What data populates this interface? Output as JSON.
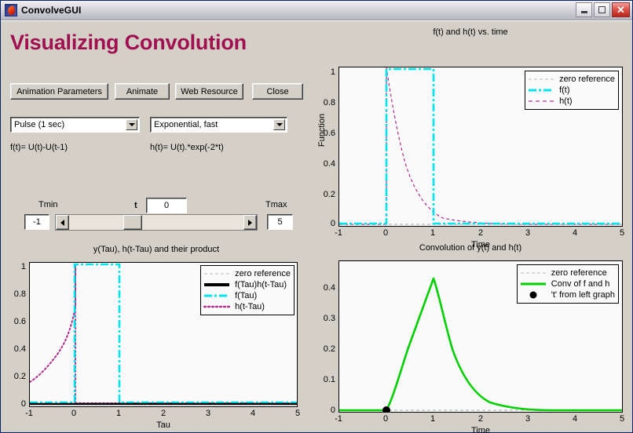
{
  "window": {
    "title": "ConvolveGUI",
    "icon": "matlab-icon",
    "minimize_label": "Minimize",
    "maximize_label": "Maximize",
    "close_label": "Close"
  },
  "header": {
    "heading": "Visualizing Convolution",
    "heading_color": "#a01050"
  },
  "toolbar": {
    "buttons": [
      {
        "label": "Animation Parameters",
        "name": "animation-parameters-button"
      },
      {
        "label": "Animate",
        "name": "animate-button"
      },
      {
        "label": "Web Resource",
        "name": "web-resource-button"
      },
      {
        "label": "Close",
        "name": "close-button"
      }
    ]
  },
  "selectors": {
    "f_select": {
      "value": "Pulse (1 sec)",
      "options": [
        "Pulse (1 sec)"
      ]
    },
    "h_select": {
      "value": "Exponential, fast",
      "options": [
        "Exponential, fast"
      ]
    },
    "f_formula": "f(t)= U(t)-U(t-1)",
    "h_formula": "h(t)= U(t).*exp(-2*t)"
  },
  "slider_panel": {
    "tmin_label": "Tmin",
    "tmin_value": "-1",
    "t_label": "t",
    "t_value": "0",
    "tmax_label": "Tmax",
    "tmax_value": "5",
    "left_arrow": "left-arrow",
    "right_arrow": "right-arrow"
  },
  "chart_data": [
    {
      "id": "top-right",
      "type": "line",
      "title": "f(t) and h(t) vs. time",
      "xlabel": "Time",
      "ylabel": "Function",
      "xlim": [
        -1,
        5
      ],
      "ylim": [
        0,
        1.05
      ],
      "xticks": [
        "-1",
        "0",
        "1",
        "2",
        "3",
        "4",
        "5"
      ],
      "yticks": [
        "0",
        "0.2",
        "0.4",
        "0.6",
        "0.8",
        "1"
      ],
      "grid": false,
      "legend_position": "top-right",
      "series": [
        {
          "name": "zero reference",
          "color": "#aaaaaa",
          "style": "dashed",
          "width": 1
        },
        {
          "name": "f(t)",
          "color": "#00e5ee",
          "style": "dash-dot",
          "width": 2.5,
          "points": [
            [
              -1,
              0
            ],
            [
              0,
              0
            ],
            [
              0,
              1
            ],
            [
              1,
              1
            ],
            [
              1,
              0
            ],
            [
              5,
              0
            ]
          ]
        },
        {
          "name": "h(t)",
          "color": "#b03090",
          "style": "dashed",
          "width": 1,
          "description": "U(t).*exp(-2*t)"
        }
      ]
    },
    {
      "id": "bottom-left",
      "type": "line",
      "title": "y(Tau), h(t-Tau) and their product",
      "xlabel": "Tau",
      "ylabel": "",
      "xlim": [
        -1,
        5
      ],
      "ylim": [
        0,
        1.05
      ],
      "xticks": [
        "-1",
        "0",
        "1",
        "2",
        "3",
        "4",
        "5"
      ],
      "yticks": [
        "0",
        "0.2",
        "0.4",
        "0.6",
        "0.8",
        "1"
      ],
      "grid": false,
      "legend_position": "top-right",
      "series": [
        {
          "name": "zero reference",
          "color": "#aaaaaa",
          "style": "dashed",
          "width": 1
        },
        {
          "name": "f(Tau)h(t-Tau)",
          "color": "#000000",
          "style": "solid",
          "width": 3
        },
        {
          "name": "f(Tau)",
          "color": "#00e5ee",
          "style": "dash-dot",
          "width": 2.5,
          "points": [
            [
              -1,
              0
            ],
            [
              0,
              0
            ],
            [
              0,
              1
            ],
            [
              1,
              1
            ],
            [
              1,
              0
            ],
            [
              5,
              0
            ]
          ]
        },
        {
          "name": "h(t-Tau)",
          "color": "#b03090",
          "style": "dotted",
          "width": 2,
          "description": "time reversed exponential, peak at Tau=0"
        }
      ]
    },
    {
      "id": "bottom-right",
      "type": "line",
      "title": "Convolution of y(t) and h(t)",
      "xlabel": "Time",
      "ylabel": "",
      "xlim": [
        -1,
        5
      ],
      "ylim": [
        0,
        0.46
      ],
      "xticks": [
        "-1",
        "0",
        "1",
        "2",
        "3",
        "4",
        "5"
      ],
      "yticks": [
        "0",
        "0.1",
        "0.2",
        "0.3",
        "0.4"
      ],
      "grid": false,
      "legend_position": "top-right",
      "peak_value": 0.432,
      "peak_time": 1.0,
      "marker_time": 0,
      "marker_value": 0,
      "series": [
        {
          "name": "zero reference",
          "color": "#aaaaaa",
          "style": "dashed",
          "width": 1
        },
        {
          "name": "Conv of f and h",
          "color": "#00d000",
          "style": "solid",
          "width": 2.5
        },
        {
          "name": "'t' from left graph",
          "color": "#000000",
          "style": "marker",
          "marker": "circle"
        }
      ]
    }
  ]
}
